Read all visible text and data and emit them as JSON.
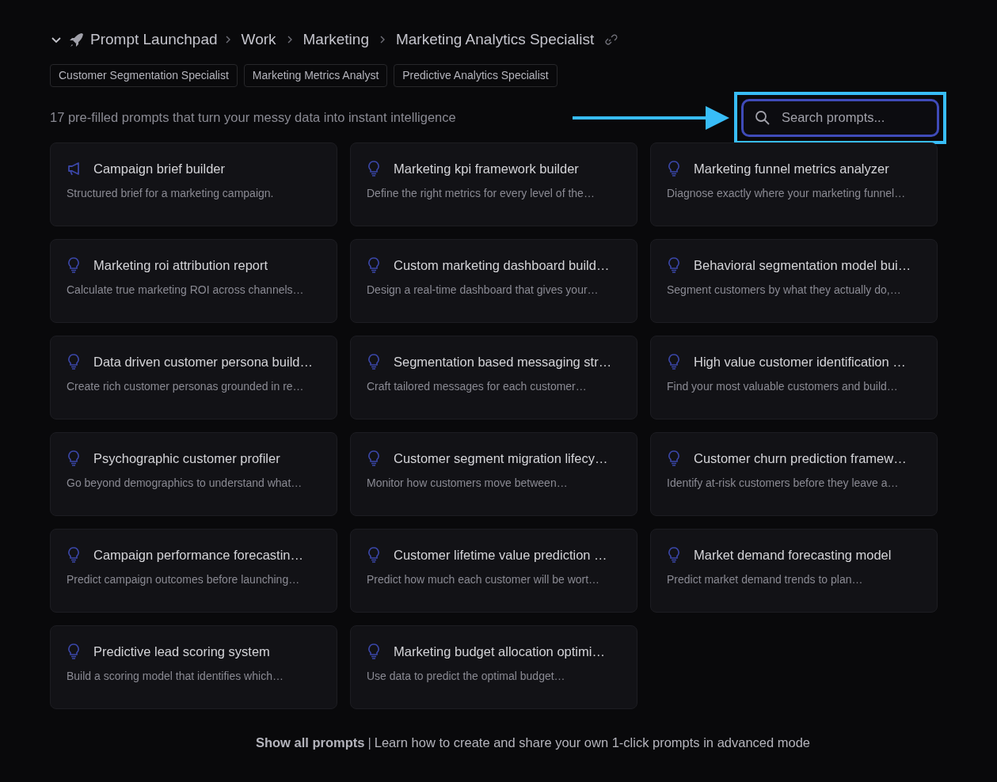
{
  "breadcrumb": {
    "expanded": true,
    "items": [
      {
        "label": "Prompt Launchpad"
      },
      {
        "label": "Work"
      },
      {
        "label": "Marketing"
      },
      {
        "label": "Marketing Analytics Specialist"
      }
    ]
  },
  "tags": [
    "Customer Segmentation Specialist",
    "Marketing Metrics Analyst",
    "Predictive Analytics Specialist"
  ],
  "subtitle": "17 pre-filled prompts that turn your messy data into instant intelligence",
  "search": {
    "placeholder": "Search prompts...",
    "focused": true
  },
  "prompts": [
    {
      "kind": "megaphone",
      "title": "Campaign brief builder",
      "description": "Structured brief for a marketing campaign."
    },
    {
      "kind": "bulb",
      "title": "Marketing kpi framework builder",
      "description": "Define the right metrics for every level of the…"
    },
    {
      "kind": "bulb",
      "title": "Marketing funnel metrics analyzer",
      "description": "Diagnose exactly where your marketing funnel…"
    },
    {
      "kind": "bulb",
      "title": "Marketing roi attribution report",
      "description": "Calculate true marketing ROI across channels…"
    },
    {
      "kind": "bulb",
      "title": "Custom marketing dashboard build…",
      "description": "Design a real-time dashboard that gives your…"
    },
    {
      "kind": "bulb",
      "title": "Behavioral segmentation model bui…",
      "description": "Segment customers by what they actually do,…"
    },
    {
      "kind": "bulb",
      "title": "Data driven customer persona build…",
      "description": "Create rich customer personas grounded in re…"
    },
    {
      "kind": "bulb",
      "title": "Segmentation based messaging str…",
      "description": "Craft tailored messages for each customer…"
    },
    {
      "kind": "bulb",
      "title": "High value customer identification …",
      "description": "Find your most valuable customers and build…"
    },
    {
      "kind": "bulb",
      "title": "Psychographic customer profiler",
      "description": "Go beyond demographics to understand what…"
    },
    {
      "kind": "bulb",
      "title": "Customer segment migration lifecy…",
      "description": "Monitor how customers move between…"
    },
    {
      "kind": "bulb",
      "title": "Customer churn prediction framew…",
      "description": "Identify at-risk customers before they leave a…"
    },
    {
      "kind": "bulb",
      "title": "Campaign performance forecastin…",
      "description": "Predict campaign outcomes before launching…"
    },
    {
      "kind": "bulb",
      "title": "Customer lifetime value prediction …",
      "description": "Predict how much each customer will be wort…"
    },
    {
      "kind": "bulb",
      "title": "Market demand forecasting model",
      "description": "Predict market demand trends to plan…"
    },
    {
      "kind": "bulb",
      "title": "Predictive lead scoring system",
      "description": "Build a scoring model that identifies which…"
    },
    {
      "kind": "bulb",
      "title": "Marketing budget allocation optimi…",
      "description": "Use data to predict the optimal budget…"
    }
  ],
  "footer": {
    "show_all": "Show all prompts",
    "separator": "|",
    "learn_link": "Learn how to create and share your own 1-click prompts in advanced mode"
  }
}
